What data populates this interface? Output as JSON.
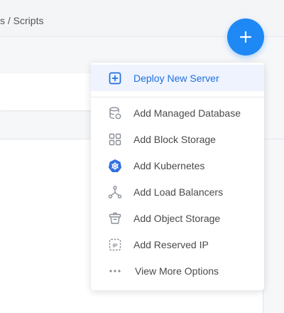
{
  "breadcrumb": {
    "text": "s / Scripts"
  },
  "fab": {
    "label": "+"
  },
  "menu": {
    "primary": {
      "label": "Deploy New Server",
      "icon": "plus-square-icon"
    },
    "items": [
      {
        "label": "Add Managed Database",
        "icon": "database-icon"
      },
      {
        "label": "Add Block Storage",
        "icon": "grid-blocks-icon"
      },
      {
        "label": "Add Kubernetes",
        "icon": "kubernetes-icon"
      },
      {
        "label": "Add Load Balancers",
        "icon": "load-balancer-icon"
      },
      {
        "label": "Add Object Storage",
        "icon": "bucket-icon"
      },
      {
        "label": "Add Reserved IP",
        "icon": "reserved-ip-icon"
      },
      {
        "label": "View More Options",
        "icon": "more-dots-icon"
      }
    ]
  },
  "colors": {
    "accent": "#1e88f5",
    "primary_text": "#1e6fe0",
    "primary_bg": "#eef3fe",
    "icon_gray": "#8a8f98",
    "kubernetes": "#2f6fe0"
  }
}
